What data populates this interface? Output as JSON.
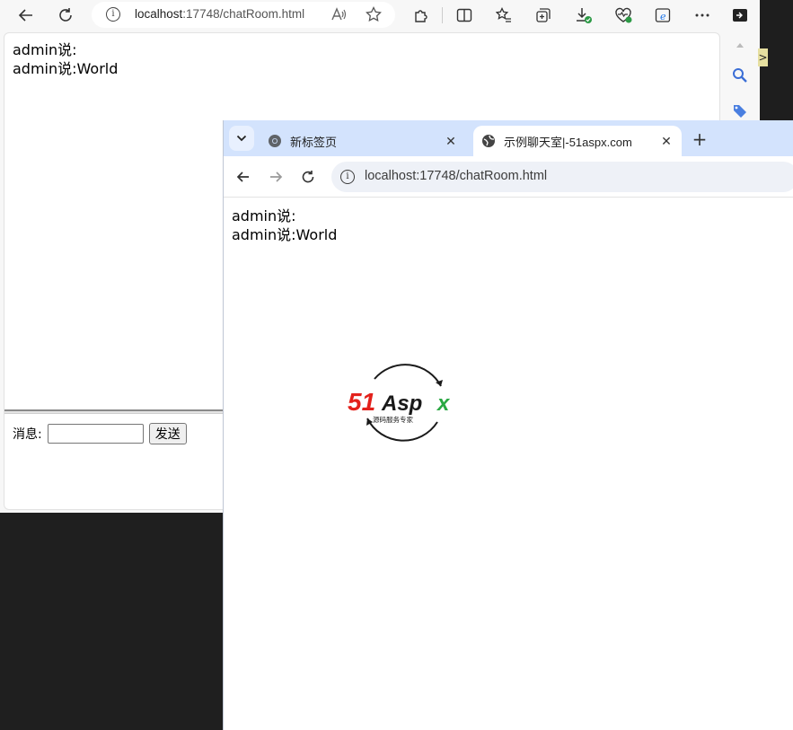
{
  "edge": {
    "url_host": "localhost",
    "url_path": ":17748/chatRoom.html",
    "messages": [
      "admin说:",
      "admin说:World"
    ],
    "form": {
      "label": "消息:",
      "input_value": "",
      "send_label": "发送"
    }
  },
  "chrome": {
    "tabs": [
      {
        "label": "新标签页",
        "active": false
      },
      {
        "label": "示例聊天室|-51aspx.com",
        "active": true
      }
    ],
    "url": "localhost:17748/chatRoom.html",
    "messages": [
      "admin说:",
      "admin说:World"
    ]
  },
  "logo": {
    "brand": "51Aspx",
    "tagline": "源码服务专家"
  },
  "colors": {
    "accent_red": "#e3211b",
    "accent_green": "#2aa843",
    "chrome_tabbar": "#d3e3fd"
  }
}
